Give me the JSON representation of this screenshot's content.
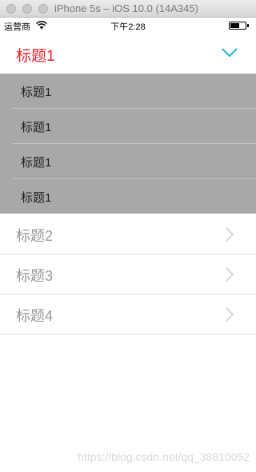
{
  "simulator": {
    "title": "iPhone 5s – iOS 10.0 (14A345)"
  },
  "status_bar": {
    "carrier": "运营商",
    "time": "下午2:28"
  },
  "header": {
    "title": "标题1",
    "accent_color": "#e8232d",
    "chevron_color": "#1ab3d8"
  },
  "submenu": {
    "items": [
      {
        "label": "标题1"
      },
      {
        "label": "标题1"
      },
      {
        "label": "标题1"
      },
      {
        "label": "标题1"
      }
    ]
  },
  "rows": [
    {
      "label": "标题2"
    },
    {
      "label": "标题3"
    },
    {
      "label": "标题4"
    }
  ],
  "watermark": "https://blog.csdn.net/qq_38810052"
}
